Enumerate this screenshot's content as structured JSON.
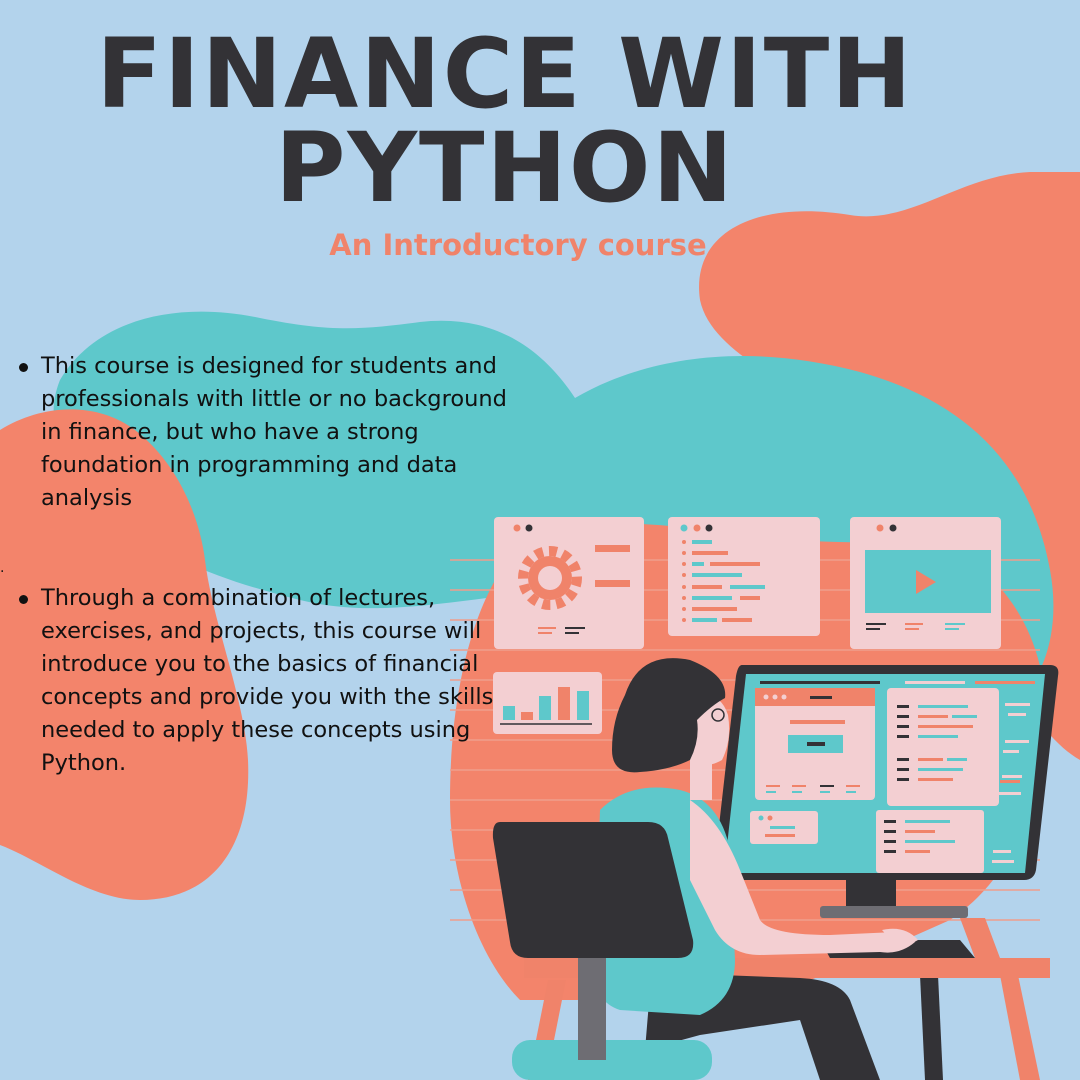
{
  "title_line1": "FINANCE WITH",
  "title_line2": "PYTHON",
  "subtitle": "An Introductory course",
  "bullets": [
    "This course is designed for students and professionals with little or no background in finance, but who have a strong foundation in programming and data analysis",
    "Through a combination of lectures, exercises, and projects, this course will introduce you to the basics of financial concepts and provide you with the skills needed to apply these concepts using Python."
  ],
  "stray_mark": ".",
  "colors": {
    "background": "#b3d3ec",
    "coral": "#f0836a",
    "teal": "#5ec8cb",
    "dark": "#333236",
    "pink": "#f3cfd2"
  }
}
